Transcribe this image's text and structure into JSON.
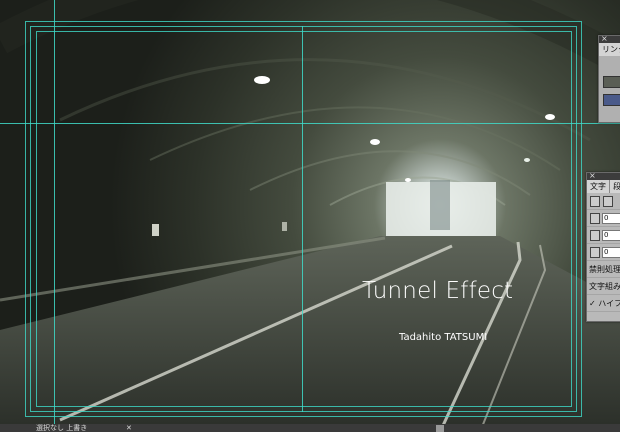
{
  "document": {
    "title": "Tunnel Effect",
    "author": "Tadahito TATSUMI"
  },
  "panels": {
    "links": {
      "tab_label": "リンク"
    },
    "character": {
      "tab_label": "文字",
      "tab_label_2": "段",
      "field1": "0",
      "field2": "0",
      "field3": "0",
      "kinsoku_label": "禁則処理：",
      "mojigumi_label": "文字組み：",
      "hyphen_label": "✓ ハイフ"
    }
  },
  "status": {
    "text": "選択なし 上書き"
  },
  "colors": {
    "guide": "#3fd9c8",
    "panel_bg": "#b9b9b9",
    "title_text": "#ffffff"
  }
}
